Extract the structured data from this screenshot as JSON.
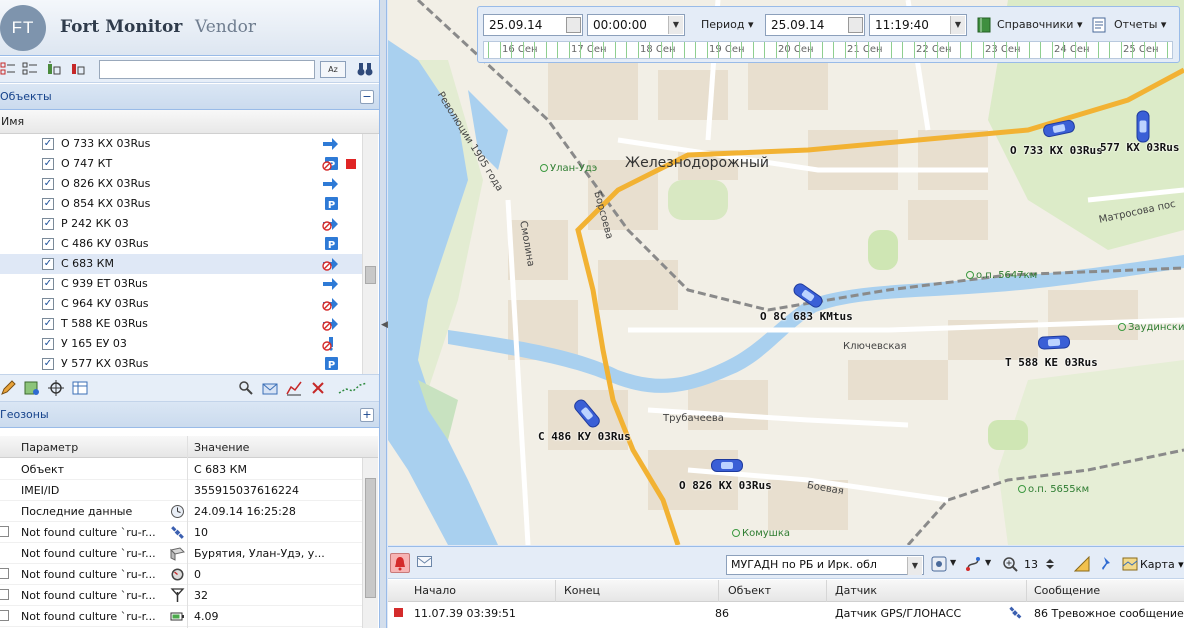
{
  "app": {
    "logo_badge": "FT",
    "logo_main": "Fort Monitor",
    "logo_sub": "Vendor"
  },
  "objects_panel": {
    "title": "Объекты",
    "collapse_symbol": "−",
    "search_value": "",
    "sort_button": "Az",
    "column_name": "Имя",
    "items": [
      {
        "name": "О 733 КХ 03Rus",
        "checked": true,
        "icon": "arrow-right-icon",
        "alert": false
      },
      {
        "name": "О 747 КТ",
        "checked": true,
        "icon": "parking-blocked-icon",
        "alert": true
      },
      {
        "name": "О 826 КХ 03Rus",
        "checked": true,
        "icon": "arrow-right-icon",
        "alert": false
      },
      {
        "name": "О 854 КХ 03Rus",
        "checked": true,
        "icon": "parking-icon",
        "alert": false
      },
      {
        "name": "Р 242 КК 03",
        "checked": true,
        "icon": "arrow-blocked-icon",
        "alert": false
      },
      {
        "name": "С 486 КУ 03Rus",
        "checked": true,
        "icon": "parking-icon",
        "alert": false
      },
      {
        "name": "С 683 КМ",
        "checked": true,
        "icon": "arrow-blocked-icon",
        "alert": false,
        "selected": true
      },
      {
        "name": "С 939 ЕТ 03Rus",
        "checked": true,
        "icon": "arrow-right-icon",
        "alert": false
      },
      {
        "name": "С 964 КУ 03Rus",
        "checked": true,
        "icon": "arrow-blocked-icon",
        "alert": false
      },
      {
        "name": "Т 588 КЕ 03Rus",
        "checked": true,
        "icon": "arrow-blocked-icon",
        "alert": false
      },
      {
        "name": "У 165 ЕУ 03",
        "checked": true,
        "icon": "warning-icon",
        "alert": false
      },
      {
        "name": "У 577 КХ 03Rus",
        "checked": true,
        "icon": "parking-icon",
        "alert": false
      }
    ]
  },
  "geozones_panel": {
    "title": "Геозоны",
    "expand_symbol": "+"
  },
  "properties": {
    "col_param": "Параметр",
    "col_value": "Значение",
    "rows": [
      {
        "name": "Объект",
        "value": "С 683 КМ",
        "icon": "",
        "checkbox": false
      },
      {
        "name": "IMEI/ID",
        "value": "355915037616224",
        "icon": "",
        "checkbox": false
      },
      {
        "name": "Последние данные",
        "value": "24.09.14 16:25:28",
        "icon": "clock-icon",
        "checkbox": false
      },
      {
        "name": "Not found culture `ru-r...",
        "value": "10",
        "icon": "satellite-icon",
        "checkbox": true
      },
      {
        "name": "Not found culture `ru-r...",
        "value": "Бурятия, Улан-Удэ, у...",
        "icon": "address-icon",
        "checkbox": false
      },
      {
        "name": "Not found culture `ru-r...",
        "value": "0",
        "icon": "speedometer-icon",
        "checkbox": true
      },
      {
        "name": "Not found culture `ru-r...",
        "value": "32",
        "icon": "antenna-icon",
        "checkbox": true
      },
      {
        "name": "Not found culture `ru-r...",
        "value": "4.09",
        "icon": "battery-icon",
        "checkbox": true
      }
    ]
  },
  "timebar": {
    "date_from": "25.09.14",
    "time_from": "00:00:00",
    "period_label": "Период",
    "date_to": "25.09.14",
    "time_to": "11:19:40",
    "references_label": "Справочники",
    "reports_label": "Отчеты",
    "days": [
      "16 Сен",
      "17 Сен",
      "18 Сен",
      "19 Сен",
      "20 Сен",
      "21 Сен",
      "22 Сен",
      "23 Сен",
      "24 Сен",
      "25 Сен"
    ]
  },
  "map": {
    "places": {
      "district": "Железнодорожный"
    },
    "streets": {
      "revolution": "Революции 1905 года",
      "borsoeva": "Борсоева",
      "smolina": "Смолина",
      "klyuchevskaya": "Ключевская",
      "trubacheva": "Трубачеева",
      "boevaya": "Боевая",
      "matrosova": "Матросова пос"
    },
    "pois": {
      "ulan_ude": "Улан-Удэ",
      "op5647": "о.п. 5647км",
      "op5655": "о.п. 5655км",
      "zaudinsky": "Заудински",
      "komushka": "Комушка"
    },
    "vehicle_labels": {
      "v733": "О 733 КХ 03Rus",
      "v577": "577 КХ 03Rus",
      "v683": "О 8С 683 КМtus",
      "v588": "Т 588 КЕ 03Rus",
      "v486": "С 486 КУ 03Rus",
      "v826": "О 826 КХ 03Rus"
    }
  },
  "bottom": {
    "layer": "МУГАДН по РБ и Ирк. обл",
    "zoom": "13",
    "map_type": "Карта",
    "columns": [
      "Начало",
      "Конец",
      "Объект",
      "Датчик",
      "Сообщение"
    ],
    "event": {
      "start": "11.07.39 03:39:51",
      "end": "",
      "object": "86",
      "sensor": "Датчик GPS/ГЛОНАСС",
      "message": "86 Тревожное сообщение"
    }
  },
  "colors": {
    "panel_border": "#99bbe8",
    "header_text": "#15428b",
    "alert_red": "#e02424",
    "car_blue": "#3a5fd6",
    "road_orange": "#f2b233",
    "river_blue": "#a9d0ef"
  }
}
